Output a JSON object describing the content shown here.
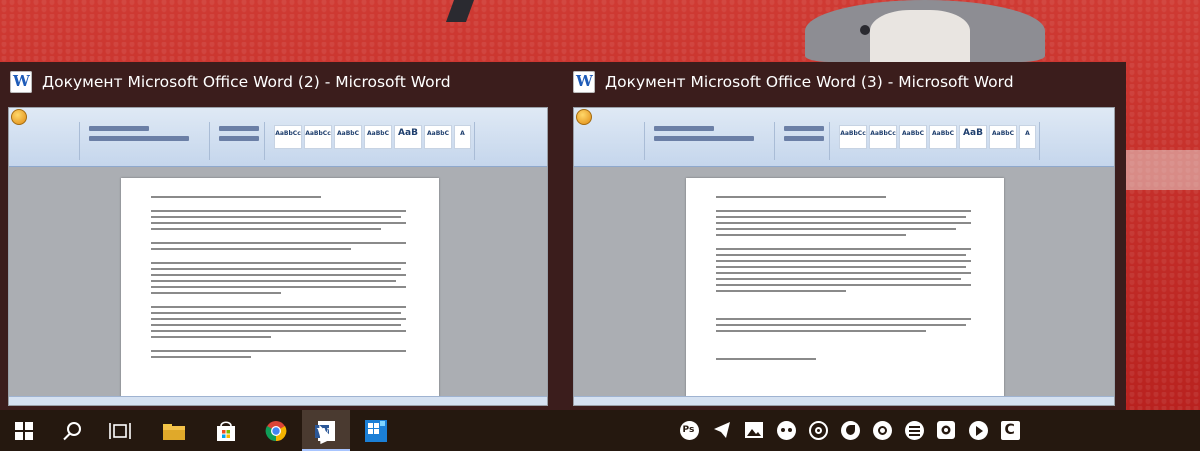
{
  "flyout": {
    "windows": [
      {
        "title": "Документ Microsoft Office Word (2) - Microsoft Word",
        "icon": "word-icon"
      },
      {
        "title": "Документ Microsoft Office Word (3) - Microsoft Word",
        "icon": "word-icon"
      }
    ]
  },
  "colors": {
    "wallpaper_red": "#c8312c",
    "flyout_bg": "#3b1d1c",
    "taskbar_bg": "#25180f",
    "active_indicator": "#a8c5ff"
  },
  "taskbar": {
    "buttons": [
      {
        "name": "start-icon"
      },
      {
        "name": "search-icon"
      },
      {
        "name": "task-view-icon"
      },
      {
        "name": "file-explorer-icon"
      },
      {
        "name": "store-icon"
      },
      {
        "name": "chrome-icon"
      },
      {
        "name": "word-icon",
        "active": true
      },
      {
        "name": "app-tile-icon"
      }
    ],
    "tray": [
      {
        "name": "photoshop-icon",
        "label": "Ps"
      },
      {
        "name": "telegram-icon"
      },
      {
        "name": "photos-icon"
      },
      {
        "name": "eye-icon"
      },
      {
        "name": "chrome-tray-icon"
      },
      {
        "name": "firefox-icon"
      },
      {
        "name": "settings-app-icon"
      },
      {
        "name": "stack-icon"
      },
      {
        "name": "media-icon"
      },
      {
        "name": "play-icon"
      },
      {
        "name": "ccleaner-icon",
        "label": "C"
      }
    ]
  }
}
